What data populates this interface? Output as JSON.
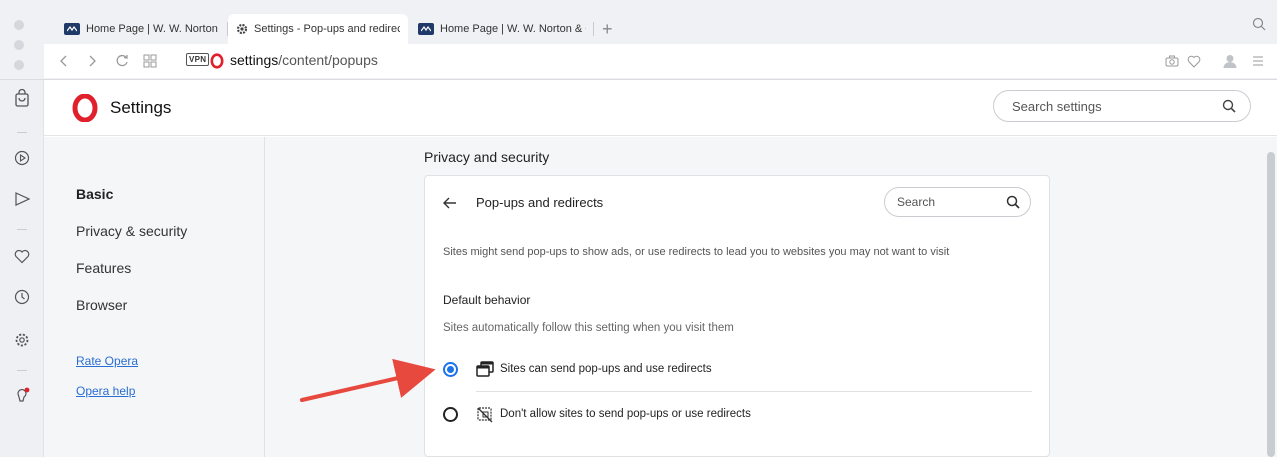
{
  "browser": {
    "tabs": [
      {
        "label": "Home Page | W. W. Norton & C",
        "active": false
      },
      {
        "label": "Settings - Pop-ups and redirec",
        "active": true
      },
      {
        "label": "Home Page | W. W. Norton & C",
        "active": false
      }
    ],
    "new_tab_glyph": "+",
    "vpn_badge": "VPN",
    "url_host": "settings",
    "url_path": "/content/popups"
  },
  "opera_sidebar": {
    "icons": [
      "bag-icon",
      "play-icon",
      "send-icon",
      "heart-icon",
      "clock-icon",
      "gear-icon",
      "lightbulb-icon"
    ]
  },
  "settings": {
    "title": "Settings",
    "search_placeholder": "Search settings"
  },
  "nav": {
    "items": [
      "Basic",
      "Privacy & security",
      "Features",
      "Browser"
    ],
    "links": [
      "Rate Opera",
      "Opera help"
    ]
  },
  "content": {
    "section_title": "Privacy and security",
    "card_title": "Pop-ups and redirects",
    "card_search_placeholder": "Search",
    "description": "Sites might send pop-ups to show ads, or use redirects to lead you to websites you may not want to visit",
    "default_heading": "Default behavior",
    "default_description": "Sites automatically follow this setting when you visit them",
    "options": [
      {
        "label": "Sites can send pop-ups and use redirects",
        "selected": true
      },
      {
        "label": "Don't allow sites to send pop-ups or use redirects",
        "selected": false
      }
    ]
  },
  "colors": {
    "accent": "#1a73e8",
    "opera_red": "#e0202a",
    "annotation_arrow": "#e8493f"
  }
}
